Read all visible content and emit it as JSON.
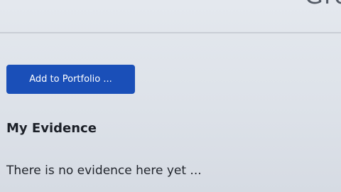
{
  "header": {
    "title_partial": "Gro"
  },
  "actions": {
    "add_to_portfolio_label": "Add to Portfolio ..."
  },
  "evidence": {
    "heading": "My Evidence",
    "empty_message": "There is no evidence here yet ..."
  },
  "colors": {
    "primary_button": "#1a4fb8",
    "background": "#dfe3ea"
  }
}
